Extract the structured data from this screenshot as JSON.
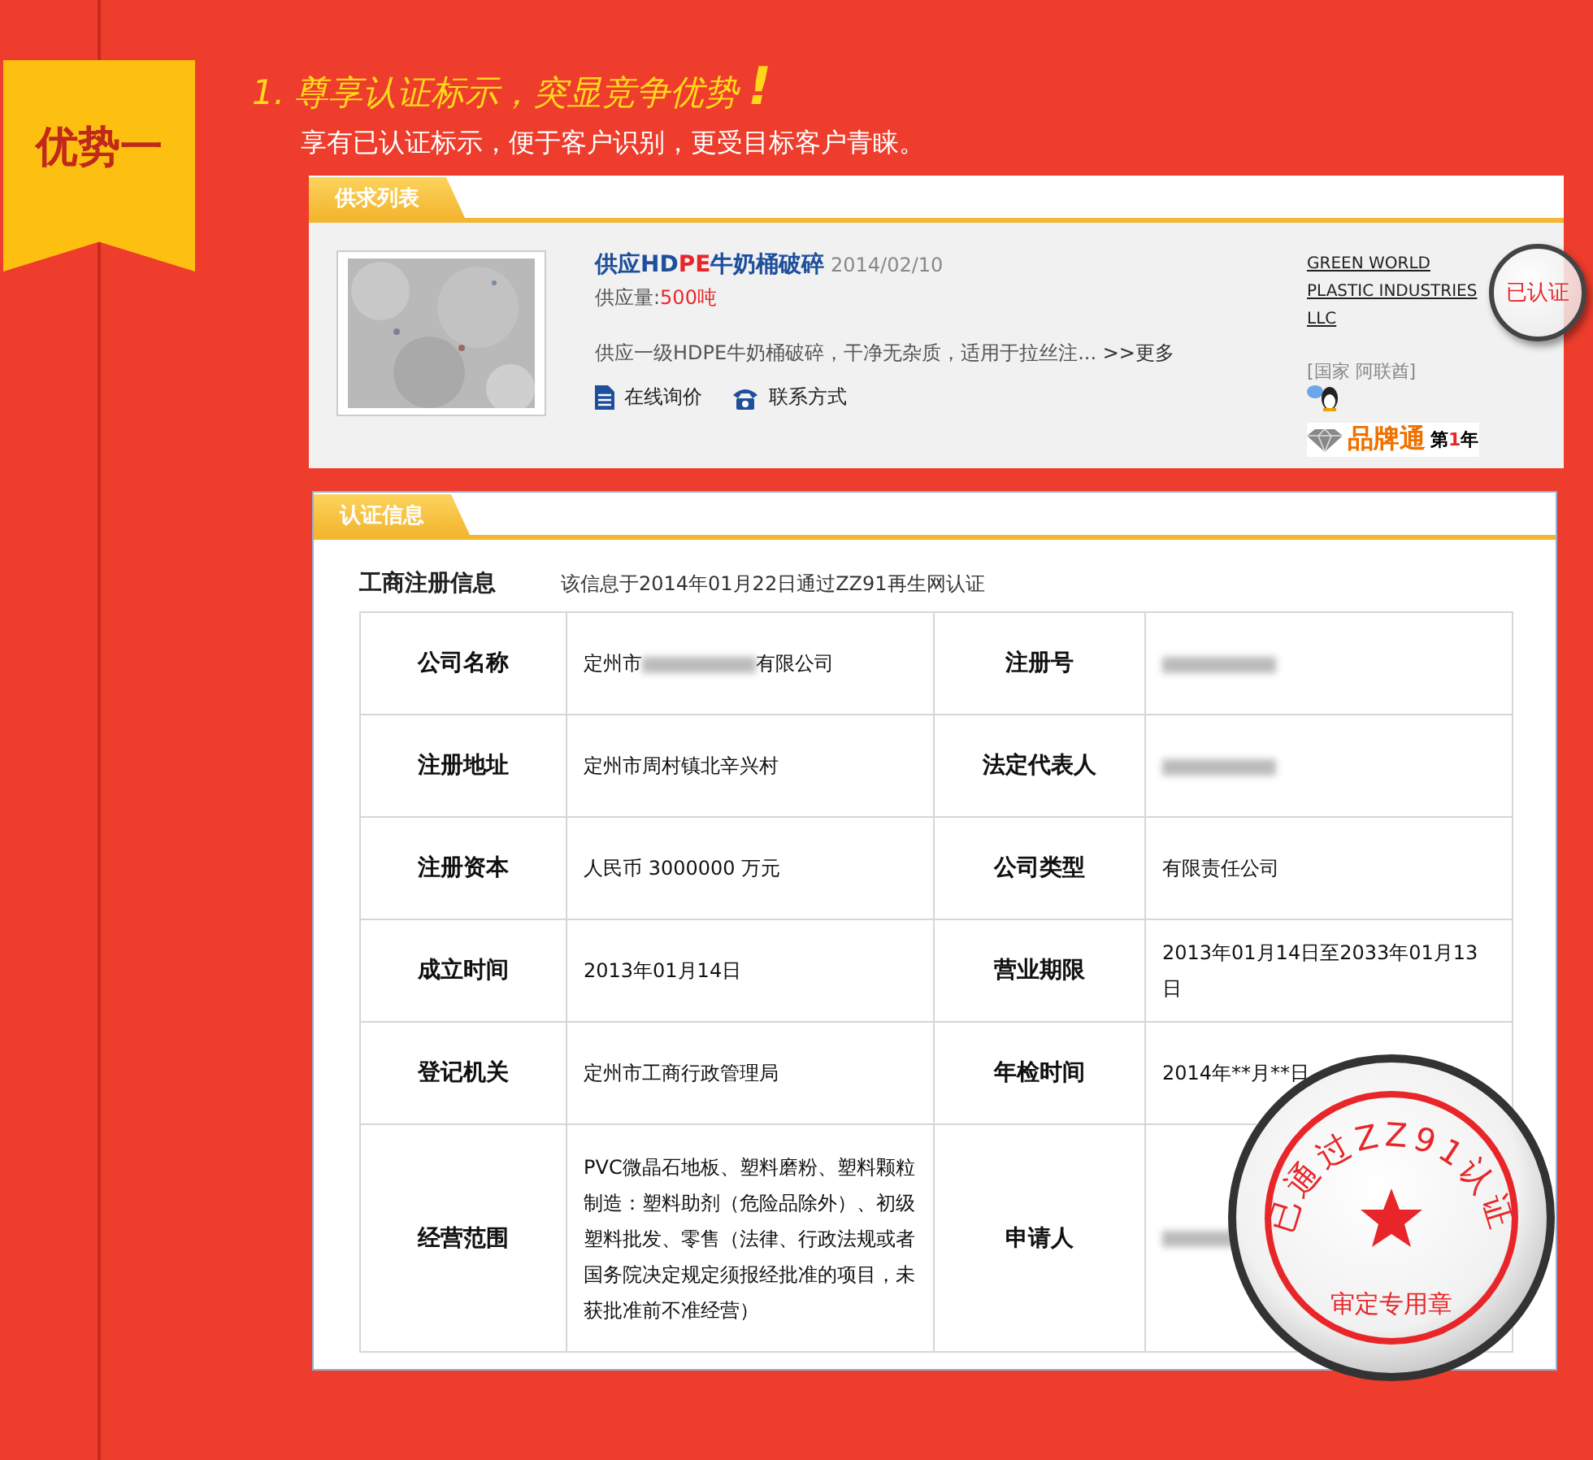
{
  "ribbon": {
    "label": "优势一"
  },
  "heading": {
    "number": "1.",
    "title": "尊享认证标示，突显竞争优势",
    "mark": "!"
  },
  "subtitle": "享有已认证标示，便于客户识别，更受目标客户青睐。",
  "supply": {
    "tab": "供求列表",
    "item": {
      "kind": "picture",
      "title": "供应HD**PE**牛奶桶破碎",
      "date": "2014/02/10",
      "qty_label": "供应量:",
      "qty": "500吨",
      "desc": "供应一级HDPE牛奶桶破碎，干净无杂质，适用于拉丝注...",
      "more": ">>更多",
      "actions": [
        "在线询价",
        "联系方式"
      ]
    },
    "seller": {
      "company": "GREEN WORLD PLASTIC INDUSTRIES LLC",
      "country": "[国家 阿联酋]",
      "badge": "已认证",
      "brand": "品牌通",
      "years_prefix": "第",
      "years": "1",
      "years_suffix": "年"
    }
  },
  "cert": {
    "tab": "认证信息",
    "label": "工商注册信息",
    "note": "该信息于2014年01月22日通过ZZ91再生网认证",
    "rows": [
      [
        {
          "label": "公司名称",
          "value_prefix": "定州市",
          "redacted": true,
          "value_suffix": "有限公司"
        },
        {
          "label": "注册号",
          "redacted": true
        }
      ],
      [
        {
          "label": "注册地址",
          "value_prefix": "定州市周村镇北辛兴村"
        },
        {
          "label": "法定代表人",
          "redacted": true
        }
      ],
      [
        {
          "label": "注册资本",
          "value_prefix": "人民币 3000000 万元"
        },
        {
          "label": "公司类型",
          "value_prefix": "有限责任公司"
        }
      ],
      [
        {
          "label": "成立时间",
          "value_prefix": "2013年01月14日"
        },
        {
          "label": "营业期限",
          "value_prefix": "2013年01月14日至2033年01月13日"
        }
      ],
      [
        {
          "label": "登记机关",
          "value_prefix": "定州市工商行政管理局"
        },
        {
          "label": "年检时间",
          "value_prefix": "2014年**月**日"
        }
      ],
      [
        {
          "label": "经营范围",
          "value_prefix": "PVC微晶石地板、塑料磨粉、塑料颗粒制造：塑料助剂（危险品除外）、初级塑料批发、零售（法律、行政法规或者国务院决定规定须报经批准的项目，未获批准前不准经营）"
        },
        {
          "label": "申请人",
          "redacted": true
        }
      ]
    ],
    "stamp": {
      "ring_text": "已通过ZZ91认证",
      "bottom_text": "审定专用章"
    }
  }
}
